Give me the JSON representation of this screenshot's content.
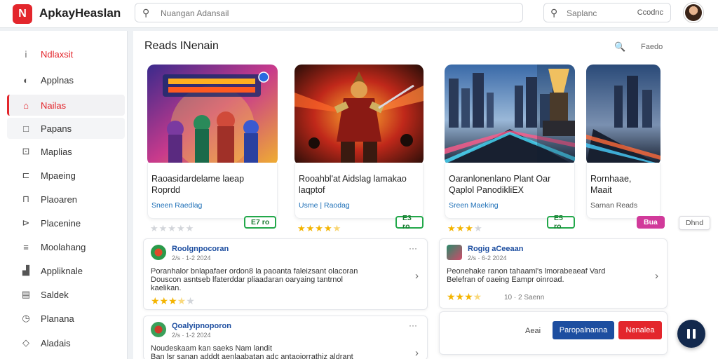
{
  "app": {
    "logo_glyph": "N",
    "title": "ApkayHeaslan"
  },
  "search": {
    "placeholder": "Nuangan Adansail"
  },
  "search_side": {
    "placeholder": "Saplanc",
    "extra": "Ccodnc"
  },
  "sidebar": {
    "items": [
      {
        "label": "Ndlaxsit",
        "icon": "info-icon",
        "glyph": "i"
      },
      {
        "label": "Applnas",
        "icon": "apps-icon",
        "glyph": "◐"
      },
      {
        "label": "Nailas",
        "icon": "home-icon",
        "glyph": "⌂"
      },
      {
        "label": "Papans",
        "icon": "square-icon",
        "glyph": "□"
      },
      {
        "label": "Maplias",
        "icon": "map-icon",
        "glyph": "⊡"
      },
      {
        "label": "Mpaeing",
        "icon": "box-icon",
        "glyph": "⊏"
      },
      {
        "label": "Plaoaren",
        "icon": "page-icon",
        "glyph": "⊓"
      },
      {
        "label": "Placenine",
        "icon": "tag-icon",
        "glyph": "⊳"
      },
      {
        "label": "Moolahang",
        "icon": "list-icon",
        "glyph": "≡"
      },
      {
        "label": "Appliknale",
        "icon": "chart-icon",
        "glyph": "▟"
      },
      {
        "label": "Saldek",
        "icon": "calendar-icon",
        "glyph": "▤"
      },
      {
        "label": "Planana",
        "icon": "clock-icon",
        "glyph": "◷"
      },
      {
        "label": "Aladais",
        "icon": "diamond-icon",
        "glyph": "◇"
      }
    ]
  },
  "section": {
    "title": "Reads INenain",
    "action_label": "Faedo",
    "action_icon": "filter-icon",
    "action_glyph": "🔍"
  },
  "cards": [
    {
      "title_line1": "Raoasidardelame laeap",
      "title_line2": "Roprdd",
      "subtitle": "Sneen Raedlag",
      "rating": 0,
      "price": "E7 ro"
    },
    {
      "title_line1": "Rooahbl'at Aidslag lamakao",
      "title_line2": "laqptof",
      "subtitle": "Usme | Raodag",
      "rating": 4.5,
      "price": "E3 ro"
    },
    {
      "title_line1": "Oaranlonenlano Plant Oar",
      "title_line2": "Qaplol PanodikliEX",
      "subtitle": "Sreen Maeking",
      "rating": 3,
      "price": "E5 ro"
    },
    {
      "title_line1": "Rornhaae,",
      "title_line2": "Maait",
      "subtitle": "Sarnan Reads",
      "price": "Bua"
    }
  ],
  "extra_pill": "Dhnd",
  "reviews": [
    {
      "name": "Roolgnpocoran",
      "meta": "2/s · 1-2 2024",
      "body_line1": "Poranhalor bnlapafaer ordon8 la paoanta faleizsant olacoran",
      "body_line2": "Douscon asntseb lfaterddar pliaadaran oaryaing tantrnol",
      "body_line3": "kaelikan.",
      "rating": 3.5
    },
    {
      "name": "Rogig aCeeaan",
      "meta": "2/s · 6-2 2024",
      "body_line1": "Peonehake ranon tahaaml's lmorabeaeaf Vard",
      "body_line2": "Belefran of oaeing Eampr oinroad.",
      "body_line3": "",
      "rating": 3.5,
      "extra": "10 · 2 Saenn"
    },
    {
      "name": "Qoalyipnoporon",
      "meta": "2/s · 1-2 2024",
      "body_line1": "Noudeskaam kan saeks Nam landit",
      "body_line2": "Ban lsr sanan adddt aenlaabatan adc antaoiorrathiz aldrant",
      "body_line3": "",
      "rating": null
    }
  ],
  "actions": {
    "text_link": "Aeai",
    "primary": "Paropalnanna",
    "danger": "Nenalea"
  },
  "colors": {
    "accent": "#e3262c",
    "link": "#1d4ea0",
    "price_green": "#22a84a",
    "star": "#f4b400"
  }
}
